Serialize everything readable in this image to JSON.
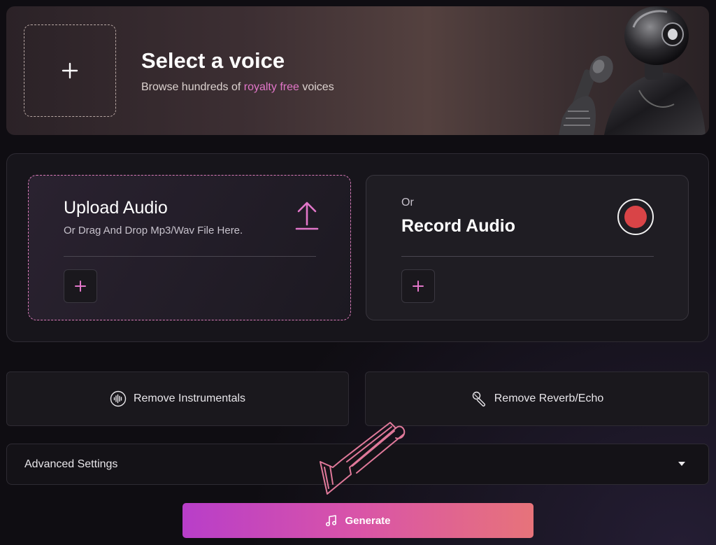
{
  "voice": {
    "title": "Select a voice",
    "subtitle_prefix": "Browse hundreds of ",
    "subtitle_highlight": "royalty free",
    "subtitle_suffix": " voices"
  },
  "upload": {
    "title": "Upload Audio",
    "subtitle": "Or Drag And Drop Mp3/Wav File Here."
  },
  "record": {
    "prefix": "Or",
    "title": "Record Audio"
  },
  "options": {
    "remove_instrumentals": "Remove Instrumentals",
    "remove_reverb": "Remove Reverb/Echo"
  },
  "advanced": {
    "label": "Advanced Settings"
  },
  "generate": {
    "label": "Generate"
  },
  "colors": {
    "accent_pink": "#e276c9",
    "record_red": "#d94447",
    "generate_start": "#b83ec9",
    "generate_end": "#e7737a"
  }
}
